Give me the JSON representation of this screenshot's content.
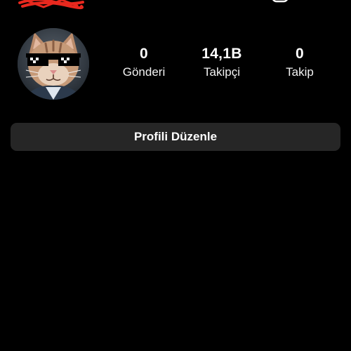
{
  "header": {
    "add_icon": "add-square-icon",
    "menu_icon": "hamburger-menu-icon",
    "redaction_color": "#e8281e"
  },
  "profile": {
    "avatar_icon": "cat-with-pixel-sunglasses-avatar",
    "stats": [
      {
        "value": "0",
        "label": "Gönderi"
      },
      {
        "value": "14,1B",
        "label": "Takipçi"
      },
      {
        "value": "0",
        "label": "Takip"
      }
    ],
    "edit_button_label": "Profili Düzenle"
  },
  "colors": {
    "background": "#000000",
    "button_background": "#262626",
    "text": "#ffffff"
  }
}
